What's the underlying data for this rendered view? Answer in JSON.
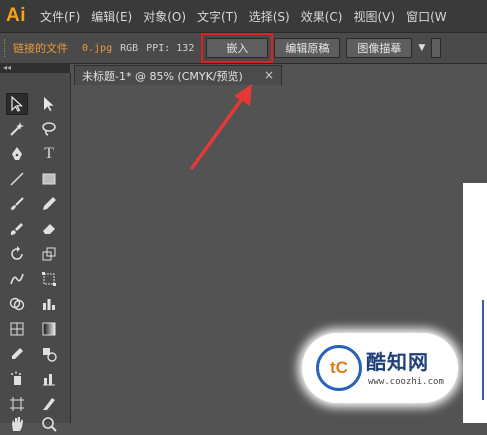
{
  "app": {
    "logo": "Ai"
  },
  "menu": [
    {
      "label": "文件(F)"
    },
    {
      "label": "编辑(E)"
    },
    {
      "label": "对象(O)"
    },
    {
      "label": "文字(T)"
    },
    {
      "label": "选择(S)"
    },
    {
      "label": "效果(C)"
    },
    {
      "label": "视图(V)"
    },
    {
      "label": "窗口(W"
    }
  ],
  "control_bar": {
    "linked_file_label": "链接的文件",
    "file_name": "0.jpg",
    "color_mode": "RGB",
    "ppi": "PPI: 132",
    "embed_button": "嵌入",
    "edit_original_button": "编辑原稿",
    "image_trace_button": "图像描摹"
  },
  "panel": {
    "collapse_arrows": "◂◂"
  },
  "document_tab": {
    "title": "未标题-1* @ 85% (CMYK/预览)",
    "close": "×"
  },
  "watermark": {
    "logo_text": "tC",
    "name": "酷知网",
    "url": "www.coozhi.com"
  },
  "colors": {
    "logo": "#f7a21b",
    "highlight": "#e02020",
    "linked_text": "#e89a3c",
    "arrow": "#e53935"
  }
}
